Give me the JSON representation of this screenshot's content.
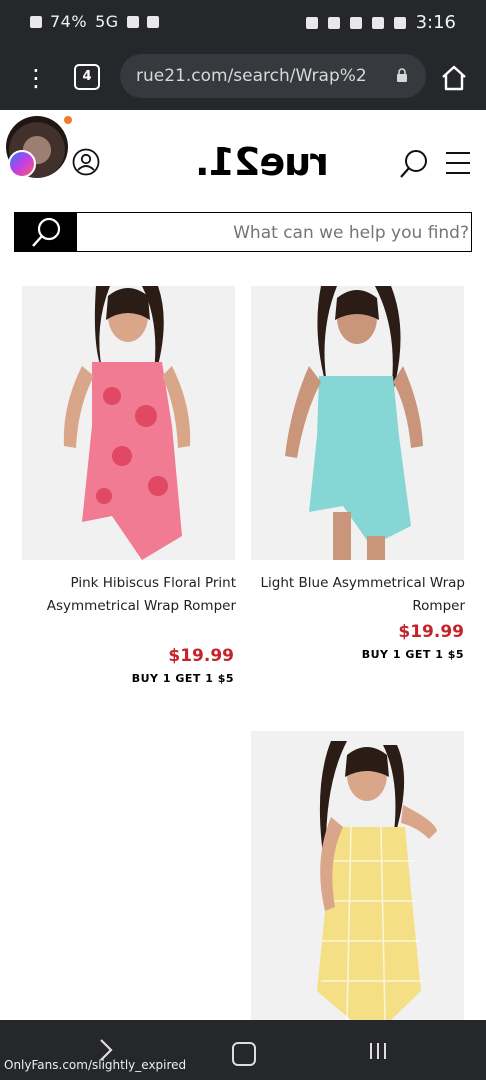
{
  "status_bar": {
    "time": "3:16",
    "battery": "74%",
    "signal": "5G"
  },
  "browser": {
    "tab_count": "4",
    "url": "rue21.com/search/Wrap%2"
  },
  "site": {
    "logo": "rue21.",
    "search_placeholder": "What can we help you find?"
  },
  "products": [
    {
      "name": "Pink Hibiscus Floral Print Asymmetrical Wrap Romper",
      "price": "$19.99",
      "promo": "BUY 1 GET 1 $5",
      "color": "#f07b92"
    },
    {
      "name": "Light Blue Asymmetrical Wrap Romper",
      "price": "$19.99",
      "promo": "BUY 1 GET 1 $5",
      "color": "#86d6d6"
    },
    {
      "name": "",
      "price": "",
      "promo": "",
      "color": "#f4df84"
    }
  ],
  "watermark": "OnlyFans.com/slightly_expired"
}
